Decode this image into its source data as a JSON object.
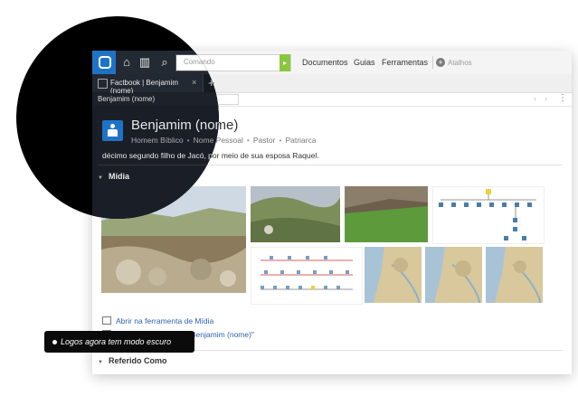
{
  "toolbar": {
    "search_placeholder": "Comando",
    "menus": [
      "Documentos",
      "Guias",
      "Ferramentas"
    ],
    "shortcuts_label": "Atalhos"
  },
  "tab": {
    "label": "Factbook | Benjamim (nome)",
    "close": "×",
    "new": "+"
  },
  "address": {
    "value": "Benjamim (nome)"
  },
  "article": {
    "title": "Benjamim (nome)",
    "types": [
      "Homem Bíblico",
      "Nome Pessoal",
      "Pastor",
      "Patriarca"
    ],
    "description": "décimo segundo filho de Jacó, por meio de sua esposa Raquel."
  },
  "sections": {
    "media": "Mídia",
    "referred": "Referido Como"
  },
  "links": {
    "open_media_tool": "Abrir na ferramenta de Mídia",
    "search_about": "Buscar mídias sobre \"Benjamim (nome)\""
  },
  "callout": {
    "text": "Logos agora tem modo escuro"
  },
  "colors": {
    "accent": "#1f73c7",
    "go": "#8cc63e",
    "dark_bg": "#1a1f27",
    "link": "#2f62ad"
  },
  "icons": [
    "logos-icon",
    "home-icon",
    "library-icon",
    "search-icon",
    "plus-circle-icon",
    "person-icon",
    "media-icon"
  ]
}
